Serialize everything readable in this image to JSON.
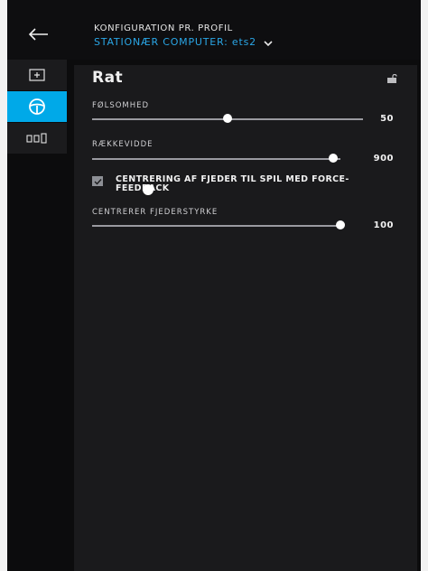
{
  "header": {
    "title": "KONFIGURATION PR. PROFIL",
    "profile": "STATIONÆR COMPUTER: ets2"
  },
  "sidebar": {
    "items": [
      {
        "icon": "add-box-icon",
        "active": false
      },
      {
        "icon": "steering-wheel-icon",
        "active": true
      },
      {
        "icon": "pedals-icon",
        "active": false
      }
    ]
  },
  "panel": {
    "title": "Rat",
    "sensitivity": {
      "label": "FØLSOMHED",
      "value": "50",
      "fraction": 0.5
    },
    "range": {
      "label": "RÆKKEVIDDE",
      "value": "900",
      "fraction": 0.97
    },
    "centering_checkbox": {
      "label": "CENTRERING AF FJEDER TIL SPIL MED FORCE-FEEDBACK",
      "checked": true
    },
    "centering_strength": {
      "label": "CENTRERER FJEDERSTYRKE",
      "value": "100",
      "fraction": 1.0
    }
  },
  "colors": {
    "accent": "#00a9e8",
    "profile_text": "#2aa6e6",
    "panel_bg": "#1a1a1c"
  }
}
